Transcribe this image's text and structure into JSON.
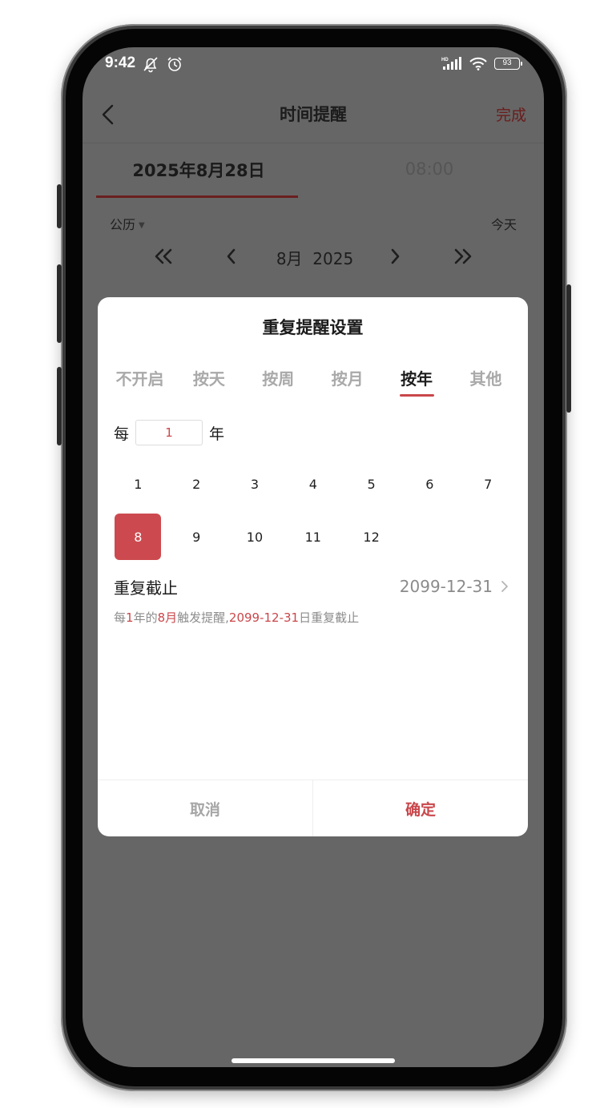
{
  "status_bar": {
    "time": "9:42",
    "battery": "93",
    "icons_left": [
      "bell-off-icon",
      "alarm-icon"
    ],
    "icons_right": [
      "hd-signal-icon",
      "wifi-icon",
      "battery-icon"
    ]
  },
  "nav": {
    "title": "时间提醒",
    "done_label": "完成"
  },
  "picker_tabs": {
    "date": "2025年8月28日",
    "time": "08:00"
  },
  "calendar": {
    "type_label": "公历",
    "today_label": "今天",
    "month_label": "8月",
    "year_label": "2025"
  },
  "modal": {
    "title": "重复提醒设置",
    "modes": [
      "不开启",
      "按天",
      "按周",
      "按月",
      "按年",
      "其他"
    ],
    "active_mode": "按年",
    "every_prefix": "每",
    "every_value": "1",
    "every_suffix": "年",
    "months": [
      "1",
      "2",
      "3",
      "4",
      "5",
      "6",
      "7",
      "8",
      "9",
      "10",
      "11",
      "12"
    ],
    "selected_month": "8",
    "end_label": "重复截止",
    "end_value": "2099-12-31",
    "summary": {
      "p1": "每",
      "h1": "1",
      "p2": "年的",
      "h2": "8月",
      "p3": "触发提醒,",
      "h3": "2099-12-31",
      "p4": "日重复截止"
    },
    "cancel_label": "取消",
    "confirm_label": "确定"
  },
  "colors": {
    "accent": "#c9474b",
    "overlay": "#666666",
    "nav_done": "#6a1c1c"
  }
}
